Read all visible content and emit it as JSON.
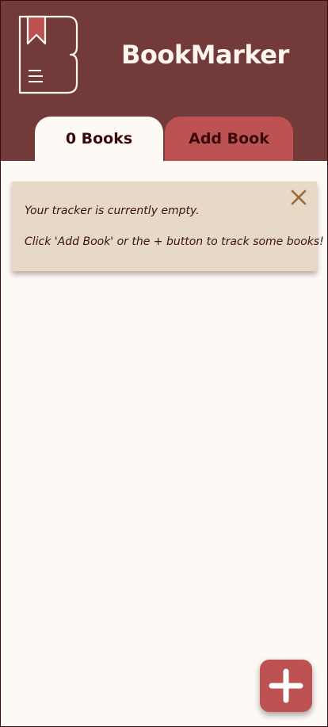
{
  "app": {
    "title": "BookMarker",
    "logo_icon": "bookmark-book-icon"
  },
  "tabs": [
    {
      "label": "0 Books",
      "active": true
    },
    {
      "label": "Add Book",
      "active": false
    }
  ],
  "notice": {
    "line1": "Your tracker is currently empty.",
    "line2": "Click 'Add Book' or the + button to track some books!",
    "close_icon": "close-icon"
  },
  "fab": {
    "icon": "plus-icon"
  },
  "colors": {
    "header": "#733a3a",
    "accent": "#bd5252",
    "background": "#fdf9f5",
    "notice": "#e8d8c6",
    "text_dark": "#3a0a0a"
  }
}
